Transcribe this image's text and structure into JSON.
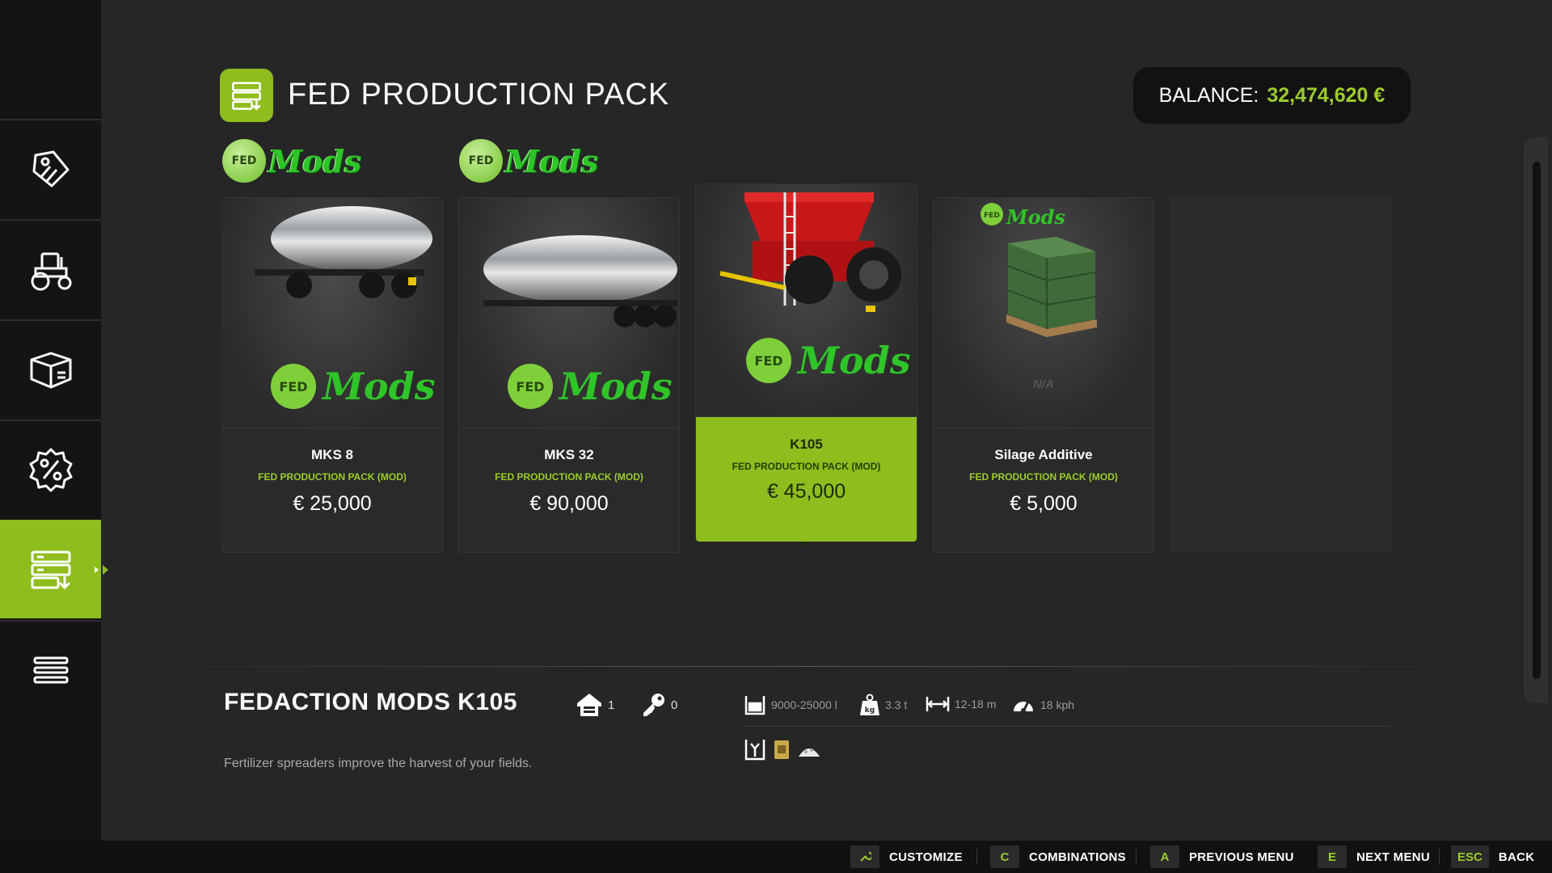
{
  "page": {
    "title": "FED PRODUCTION PACK"
  },
  "balance": {
    "label": "BALANCE:",
    "value": "32,474,620 €"
  },
  "sidebar": {
    "items": [
      {
        "icon": "price-tag-icon"
      },
      {
        "icon": "tractor-icon"
      },
      {
        "icon": "box-icon"
      },
      {
        "icon": "percent-badge-icon"
      },
      {
        "icon": "mod-pack-icon",
        "active": true
      },
      {
        "icon": "list-menu-icon"
      }
    ]
  },
  "logo": {
    "badge": "FED",
    "word": "Mods"
  },
  "cards": [
    {
      "name": "MKS 8",
      "pack": "FED PRODUCTION PACK (MOD)",
      "price": "€ 25,000",
      "image": "silver-tanker-trailer"
    },
    {
      "name": "MKS 32",
      "pack": "FED PRODUCTION PACK (MOD)",
      "price": "€ 90,000",
      "image": "silver-tanker-semitrailer"
    },
    {
      "name": "K105",
      "pack": "FED PRODUCTION PACK (MOD)",
      "price": "€ 45,000",
      "image": "red-fertilizer-spreader",
      "selected": true
    },
    {
      "name": "Silage Additive",
      "pack": "FED PRODUCTION PACK (MOD)",
      "price": "€ 5,000",
      "image": "green-pallet",
      "na": "N/A"
    }
  ],
  "detail": {
    "title": "FEDACTION MODS K105",
    "owned": "1",
    "leased": "0",
    "capacity": "9000-25000 l",
    "weight": "3.3 t",
    "width": "12-18 m",
    "speed": "18 kph",
    "fill_icons": [
      "fertilizer-icon",
      "seed-bag-icon",
      "lime-icon"
    ],
    "description": "Fertilizer spreaders improve the harvest of your fields."
  },
  "hints": [
    {
      "key": "",
      "label": "CUSTOMIZE"
    },
    {
      "key": "C",
      "label": "COMBINATIONS"
    },
    {
      "key": "A",
      "label": "PREVIOUS MENU"
    },
    {
      "key": "E",
      "label": "NEXT MENU"
    },
    {
      "key": "ESC",
      "label": "BACK"
    }
  ],
  "colors": {
    "accent": "#8fbd1e",
    "accent_text": "#9ccc2a",
    "background": "#262626",
    "sidebar": "#141414"
  }
}
